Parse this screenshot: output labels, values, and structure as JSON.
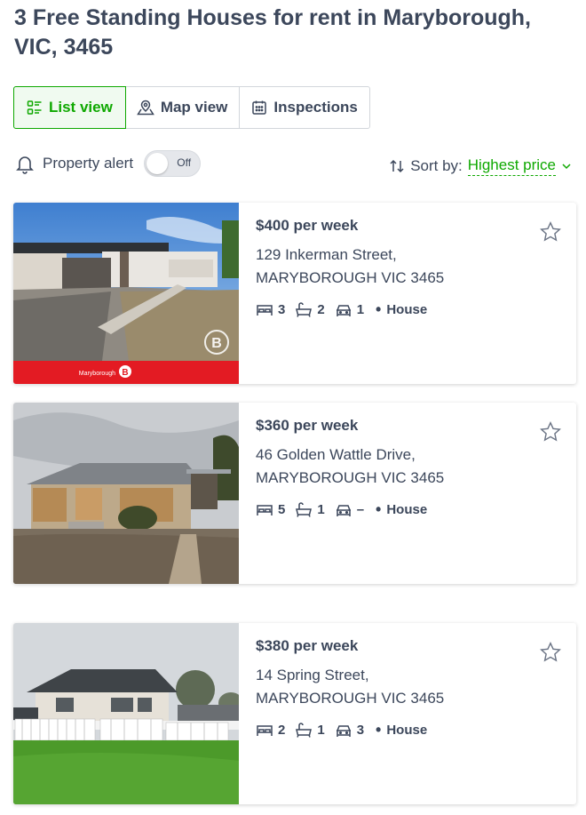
{
  "page": {
    "title": "3 Free Standing Houses for rent in Maryborough, VIC, 3465"
  },
  "views": {
    "list": "List view",
    "map": "Map view",
    "inspections": "Inspections"
  },
  "alert": {
    "label": "Property alert",
    "toggle_state": "Off"
  },
  "sort": {
    "label": "Sort by:",
    "value": "Highest price"
  },
  "listings": [
    {
      "price": "$400 per week",
      "street": "129 Inkerman Street,",
      "suburb": "MARYBOROUGH VIC 3465",
      "beds": "3",
      "baths": "2",
      "parking": "1",
      "type": "House",
      "agency_banner": "Maryborough",
      "banner_color": "#e31b23"
    },
    {
      "price": "$360 per week",
      "street": "46 Golden Wattle Drive,",
      "suburb": "MARYBOROUGH VIC 3465",
      "beds": "5",
      "baths": "1",
      "parking": "–",
      "type": "House"
    },
    {
      "price": "$380 per week",
      "street": "14 Spring Street,",
      "suburb": "MARYBOROUGH VIC 3465",
      "beds": "2",
      "baths": "1",
      "parking": "3",
      "type": "House"
    }
  ],
  "colors": {
    "accent": "#0ea800",
    "text": "#3c475b"
  }
}
